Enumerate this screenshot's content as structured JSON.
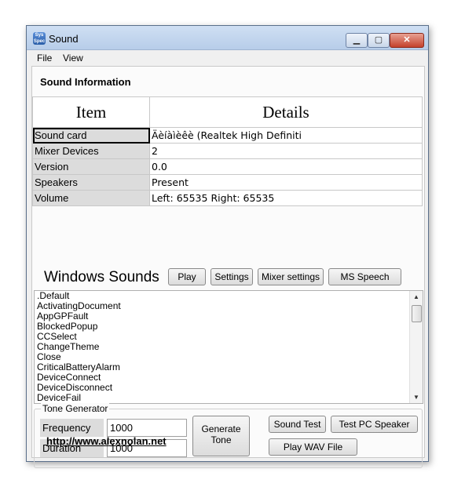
{
  "window": {
    "title": "Sound",
    "icon_text": "Sys\nSpec",
    "min_glyph": "▁",
    "max_glyph": "▢",
    "close_glyph": "✕"
  },
  "menu": [
    "File",
    "View"
  ],
  "section_title": "Sound Information",
  "table": {
    "headers": [
      "Item",
      "Details"
    ],
    "rows": [
      {
        "k": "Sound card",
        "v": "Äèíàìèêè (Realtek High Definiti"
      },
      {
        "k": "Mixer Devices",
        "v": "2"
      },
      {
        "k": "Version",
        "v": "0.0"
      },
      {
        "k": "Speakers",
        "v": "Present"
      },
      {
        "k": "Volume",
        "v": "Left: 65535 Right: 65535"
      }
    ]
  },
  "windows_sounds": {
    "title": "Windows Sounds",
    "buttons": [
      "Play",
      "Settings",
      "Mixer settings",
      "MS Speech"
    ],
    "list": [
      ".Default",
      "ActivatingDocument",
      "AppGPFault",
      "BlockedPopup",
      "CCSelect",
      "ChangeTheme",
      "Close",
      "CriticalBatteryAlarm",
      "DeviceConnect",
      "DeviceDisconnect",
      "DeviceFail"
    ]
  },
  "tone": {
    "legend": "Tone Generator",
    "frequency_label": "Frequency",
    "frequency_value": "1000",
    "duration_label": "Duration",
    "duration_value": "1000",
    "generate_label": "Generate Tone",
    "sound_test": "Sound Test",
    "test_pc_speaker": "Test PC Speaker",
    "play_wav": "Play WAV File"
  },
  "link": "http://www.alexnolan.net"
}
